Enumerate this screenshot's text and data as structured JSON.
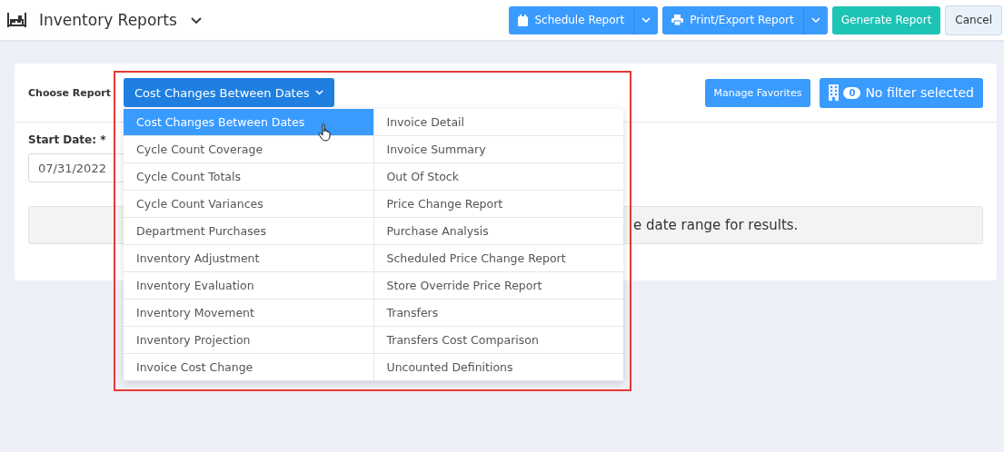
{
  "header": {
    "title": "Inventory Reports",
    "actions": [
      {
        "label": "Schedule Report",
        "kind": "schedule"
      },
      {
        "label": "Print/Export Report",
        "kind": "export"
      },
      {
        "label": "Generate Report",
        "kind": "primary"
      },
      {
        "label": "Cancel",
        "kind": "plain"
      }
    ]
  },
  "report_picker": {
    "label": "Choose Report",
    "value": "Cost Changes Between Dates",
    "expanded": true,
    "columns": [
      {
        "items": [
          {
            "label": "Cost Changes Between Dates",
            "selected": true
          },
          {
            "label": "Cycle Count Coverage",
            "selected": false
          },
          {
            "label": "Cycle Count Totals",
            "selected": false
          },
          {
            "label": "Cycle Count Variances",
            "selected": false
          },
          {
            "label": "Department Purchases",
            "selected": false
          },
          {
            "label": "Inventory Adjustment",
            "selected": false
          },
          {
            "label": "Inventory Evaluation",
            "selected": false
          },
          {
            "label": "Inventory Movement",
            "selected": false
          },
          {
            "label": "Inventory Projection",
            "selected": false
          },
          {
            "label": "Invoice Cost Change",
            "selected": false
          }
        ]
      },
      {
        "items": [
          {
            "label": "Invoice Detail",
            "selected": false
          },
          {
            "label": "Invoice Summary",
            "selected": false
          },
          {
            "label": "Out Of Stock",
            "selected": false
          },
          {
            "label": "Price Change Report",
            "selected": false
          },
          {
            "label": "Purchase Analysis",
            "selected": false
          },
          {
            "label": "Scheduled Price Change Report",
            "selected": false
          },
          {
            "label": "Store Override Price Report",
            "selected": false
          },
          {
            "label": "Transfers",
            "selected": false
          },
          {
            "label": "Transfers Cost Comparison",
            "selected": false
          },
          {
            "label": "Uncounted Definitions",
            "selected": false
          }
        ]
      }
    ]
  },
  "manage_favorites": "Manage Favorites",
  "filter": {
    "count": "0",
    "label": "No filter selected"
  },
  "start_date": {
    "label": "Start Date: *",
    "value": "07/31/2022"
  },
  "message": "e date range for results."
}
